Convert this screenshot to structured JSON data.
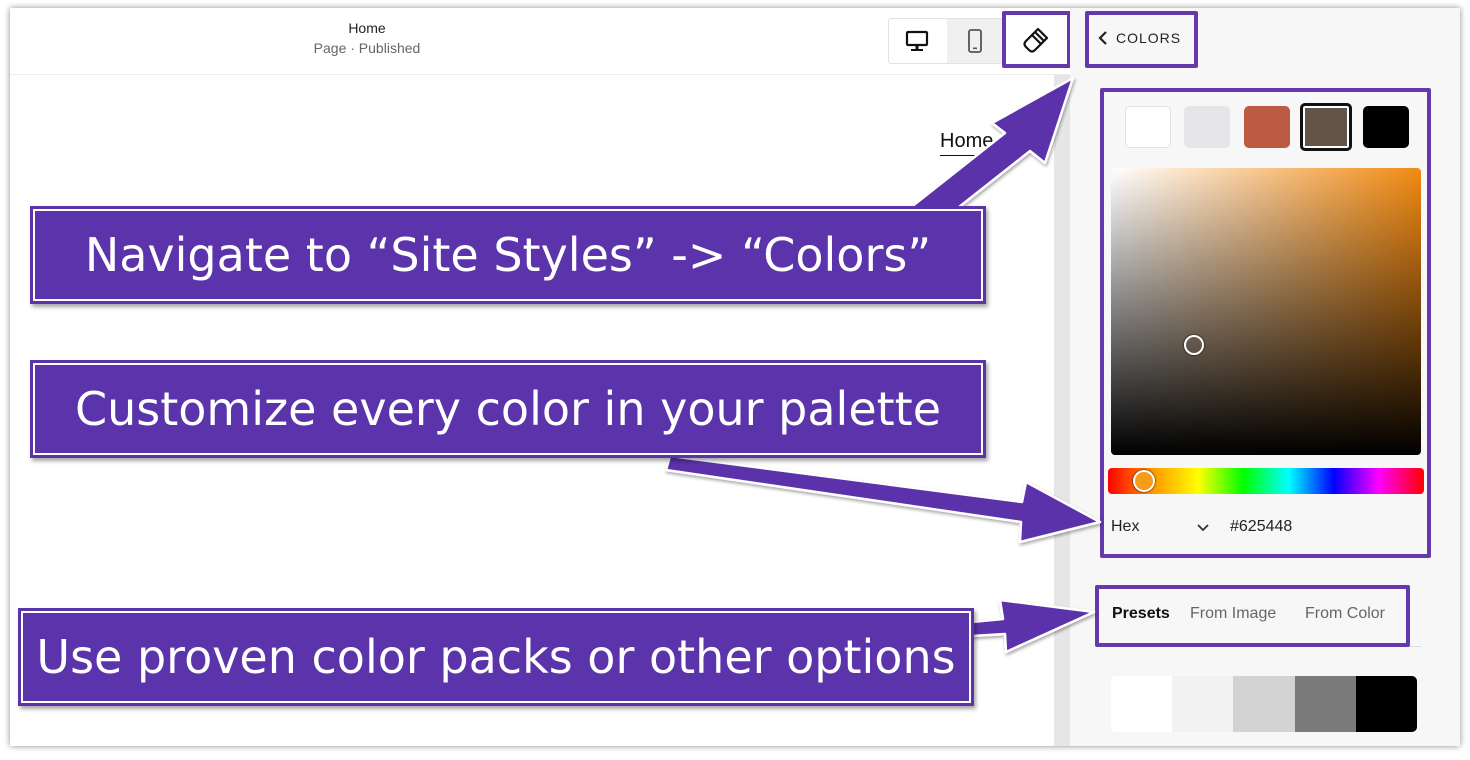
{
  "header": {
    "page_title": "Home",
    "page_status": "Page · Published"
  },
  "toolbar": {
    "desktop_icon": "desktop-icon",
    "mobile_icon": "mobile-icon",
    "brush_icon": "paint-brush-icon"
  },
  "preview": {
    "nav_home": "Home"
  },
  "panel": {
    "back_label": "COLORS",
    "swatches": [
      "#ffffff",
      "#e6e6ea",
      "#bc5a44",
      "#625448",
      "#000000"
    ],
    "selected_swatch": "#625448",
    "picker": {
      "format_label": "Hex",
      "hex_value": "#625448"
    },
    "tabs": [
      "Presets",
      "From Image",
      "From Color"
    ],
    "active_tab": "Presets",
    "preset_pack": [
      "#ffffff",
      "#f2f2f2",
      "#d3d3d3",
      "#7a7a7a",
      "#000000"
    ]
  },
  "callouts": {
    "navigate": "Navigate to “Site Styles” -> “Colors”",
    "customize": "Customize every color in your palette",
    "presets": "Use proven color packs or other options"
  },
  "accent_color": "#5b33ab"
}
